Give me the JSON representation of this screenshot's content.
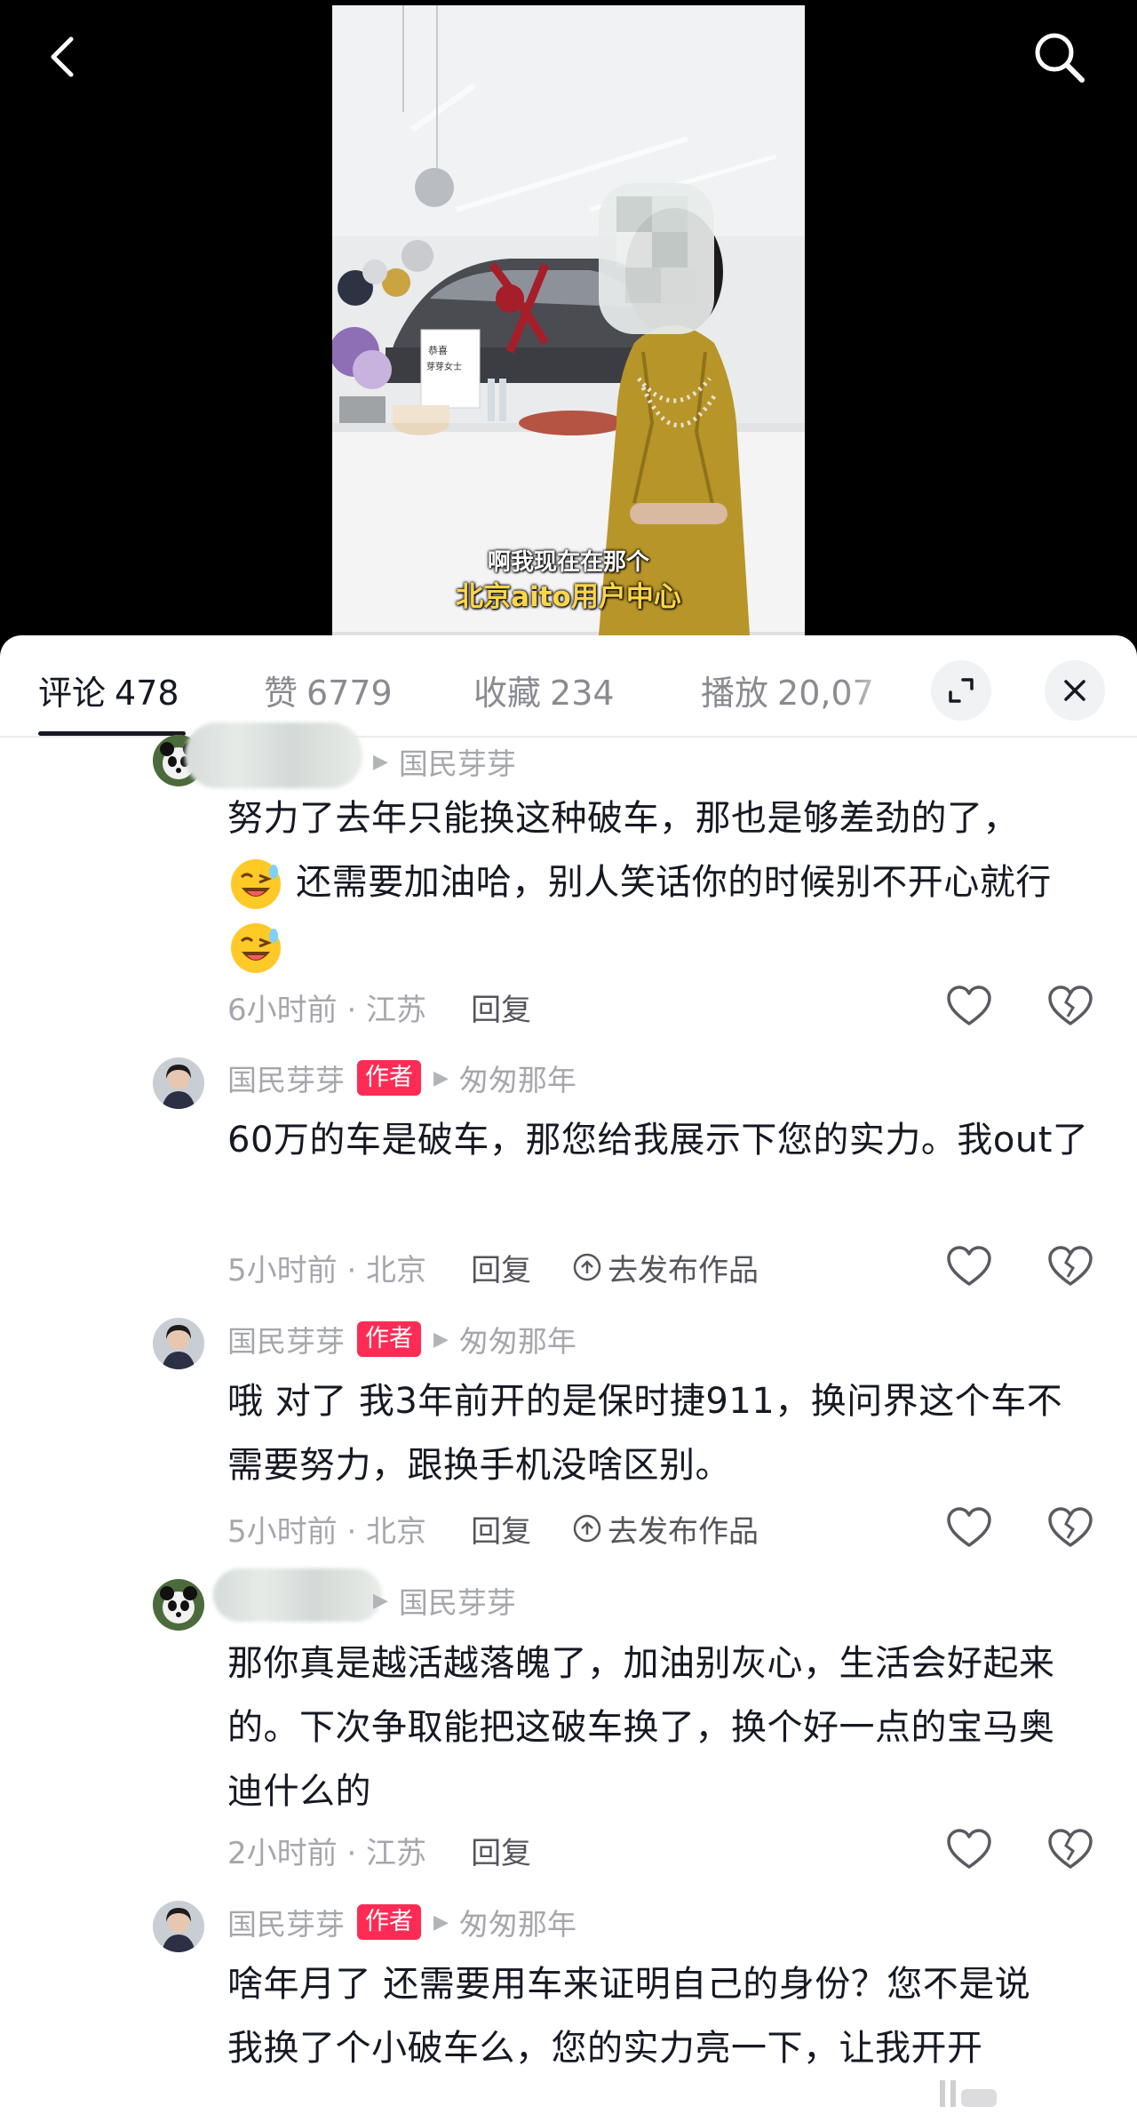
{
  "video": {
    "subtitle_line1": "啊我现在在那个",
    "subtitle_line2": "北京aito用户中心",
    "sign_text_1": "恭喜",
    "sign_text_2": "芽芽女士"
  },
  "tabs": [
    {
      "label": "评论",
      "count": "478"
    },
    {
      "label": "赞",
      "count": "6779"
    },
    {
      "label": "收藏",
      "count": "234"
    },
    {
      "label": "播放",
      "count": "20,07"
    }
  ],
  "icons": {
    "back": "back-arrow-icon",
    "search": "search-icon",
    "expand": "expand-icon",
    "close": "close-icon",
    "like": "heart-icon",
    "dislike": "broken-heart-icon",
    "post": "arrow-up-circle-icon"
  },
  "colors": {
    "author_badge": "#fe2c55",
    "text": "#161823",
    "muted": "#a6a7ac"
  },
  "comments": [
    {
      "reply_to": "国民芽芽",
      "text_line1": "努力了去年只能换这种破车，那也是够差劲的了，",
      "text_line2": "还需要加油哈，别人笑话你的时候别不开心就行",
      "meta": "6小时前 · 江苏",
      "reply": "回复"
    },
    {
      "name": "国民芽芽",
      "badge": "作者",
      "reply_to": "匆匆那年",
      "text": "60万的车是破车，那您给我展示下您的实力。我out了",
      "meta": "5小时前 · 北京",
      "reply": "回复",
      "post": "去发布作品"
    },
    {
      "name": "国民芽芽",
      "badge": "作者",
      "reply_to": "匆匆那年",
      "text": "哦 对了 我3年前开的是保时捷911，换问界这个车不需要努力，跟换手机没啥区别。",
      "meta": "5小时前 · 北京",
      "reply": "回复",
      "post": "去发布作品"
    },
    {
      "reply_to": "国民芽芽",
      "text": "那你真是越活越落魄了，加油别灰心，生活会好起来的。下次争取能把这破车换了，换个好一点的宝马奥迪什么的",
      "meta": "2小时前 · 江苏",
      "reply": "回复"
    },
    {
      "name": "国民芽芽",
      "badge": "作者",
      "reply_to": "匆匆那年",
      "text_line1": "啥年月了 还需要用车来证明自己的身份？您不是说",
      "text_line2": "我换了个小破车么，您的实力亮一下，让我开开"
    }
  ]
}
